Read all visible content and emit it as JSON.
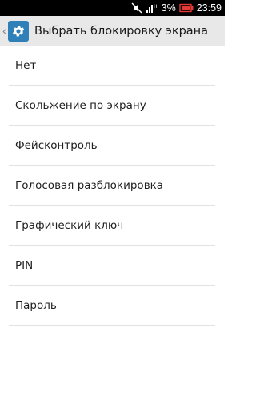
{
  "status_bar": {
    "battery_percent": "3%",
    "time": "23:59",
    "icons": [
      "mute-icon",
      "signal-icon",
      "battery-icon"
    ]
  },
  "app_bar": {
    "title": "Выбрать блокировку экрана",
    "icon": "settings-gear-icon"
  },
  "options": [
    {
      "label": "Нет"
    },
    {
      "label": "Скольжение по экрану"
    },
    {
      "label": "Фейсконтроль"
    },
    {
      "label": "Голосовая разблокировка"
    },
    {
      "label": "Графический ключ"
    },
    {
      "label": "PIN"
    },
    {
      "label": "Пароль"
    }
  ],
  "colors": {
    "accent": "#2f7fb8",
    "app_bar_bg": "#e8e8e8",
    "status_bar_bg": "#000000",
    "battery_alert": "#e53935"
  }
}
